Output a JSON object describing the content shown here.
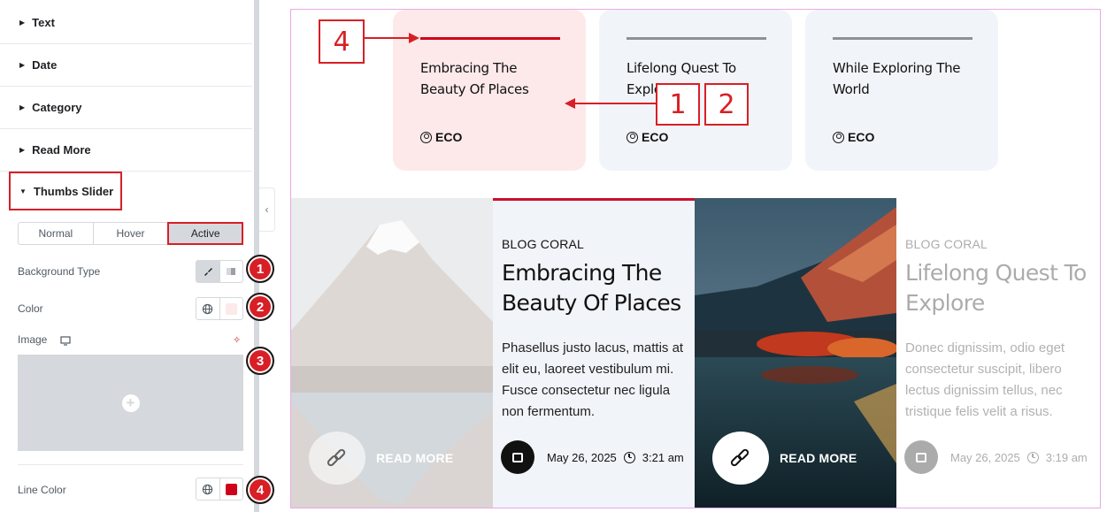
{
  "panel": {
    "sections": [
      {
        "label": "Text"
      },
      {
        "label": "Date"
      },
      {
        "label": "Category"
      },
      {
        "label": "Read More"
      }
    ],
    "thumbs_slider": {
      "label": "Thumbs Slider"
    },
    "state_tabs": [
      {
        "label": "Normal",
        "active": false
      },
      {
        "label": "Hover",
        "active": false
      },
      {
        "label": "Active",
        "active": true
      }
    ],
    "background_type_label": "Background Type",
    "color_label": "Color",
    "color_value": "#fde9ea",
    "image_label": "Image",
    "line_color_label": "Line Color",
    "line_color_value": "#d0021b"
  },
  "badges": [
    "1",
    "2",
    "3",
    "4"
  ],
  "annotations": {
    "box4": "4",
    "box1": "1",
    "box2": "2"
  },
  "thumbs": [
    {
      "title": "Embracing The Beauty Of Places",
      "category": "ECO",
      "active": true
    },
    {
      "title": "Lifelong Quest To Explore",
      "category": "ECO",
      "active": false
    },
    {
      "title": "While Exploring The World",
      "category": "ECO",
      "active": false
    }
  ],
  "slides": [
    {
      "category": "BLOG CORAL",
      "title": "Embracing The Beauty Of Places",
      "description": "Phasellus justo lacus, mattis at elit eu, laoreet vestibulum mi. Fusce consectetur nec ligula non fermentum.",
      "date": "May 26, 2025",
      "time": "3:21 am",
      "read_more": "READ MORE"
    },
    {
      "category": "BLOG CORAL",
      "title": "Lifelong Quest To Explore",
      "description": "Donec dignissim, odio eget consectetur suscipit, libero lectus dignissim tellus, nec tristique felis velit a risus.",
      "date": "May 26, 2025",
      "time": "3:19 am",
      "read_more": "READ MORE"
    }
  ],
  "colors": {
    "accent_red": "#d81f26",
    "active_thumb_bg": "#fde9ea",
    "inactive_thumb_bg": "#f1f4f9",
    "active_line": "#d0021b",
    "inactive_line": "#8c9298",
    "preview_border": "#e7a8e9"
  },
  "icons": {
    "caret": "caret-right-icon",
    "user": "user-circle-icon",
    "calendar": "calendar-icon",
    "clock": "clock-icon",
    "link": "link-icon",
    "globe": "globe-icon",
    "monitor": "monitor-icon",
    "ai_sparkle": "sparkle-icon",
    "collapse": "chevron-left-icon"
  }
}
